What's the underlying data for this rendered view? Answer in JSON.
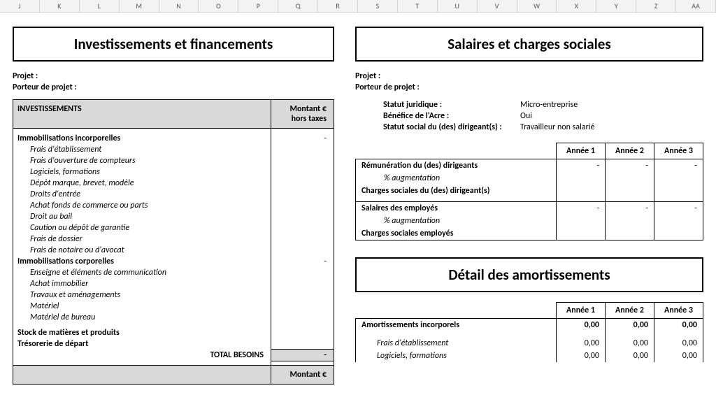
{
  "columns": [
    "J",
    "K",
    "L",
    "M",
    "N",
    "O",
    "P",
    "Q",
    "R",
    "S",
    "T",
    "U",
    "V",
    "W",
    "X",
    "Y",
    "Z",
    "AA"
  ],
  "left": {
    "title": "Investissements et financements",
    "meta": {
      "project": "Projet :",
      "carrier": "Porteur de projet :"
    },
    "header": {
      "label": "INVESTISSEMENTS",
      "amount": "Montant € hors taxes"
    },
    "sec_incorp": "Immobilisations incorporelles",
    "incorp_items": [
      "Frais d'établissement",
      "Frais d'ouverture de compteurs",
      "Logiciels, formations",
      "Dépôt marque, brevet, modèle",
      "Droits d'entrée",
      "Achat fonds de commerce ou parts",
      "Droit au bail",
      "Caution ou dépôt de garantie",
      "Frais de dossier",
      "Frais de notaire ou d'avocat"
    ],
    "sec_corp": "Immobilisations corporelles",
    "corp_items": [
      "Enseigne et éléments de communication",
      "Achat immobilier",
      "Travaux et aménagements",
      "Matériel",
      "Matériel de bureau"
    ],
    "stock": "Stock de matières et produits",
    "treso": "Trésorerie de départ",
    "total": "TOTAL BESOINS",
    "dash": "-",
    "footer_amount": "Montant €"
  },
  "right": {
    "title1": "Salaires et charges sociales",
    "meta": {
      "project": "Projet :",
      "carrier": "Porteur de projet :"
    },
    "status": [
      {
        "k": "Statut juridique :",
        "v": "Micro-entreprise"
      },
      {
        "k": "Bénéfice de l'Acre :",
        "v": "Oui"
      },
      {
        "k": "Statut social du (des) dirigeant(s) :",
        "v": "Travailleur non salarié"
      }
    ],
    "years": [
      "Année 1",
      "Année 2",
      "Année 3"
    ],
    "sal_rows": [
      {
        "lbl": "Rémunération du (des) dirigeants",
        "bold": true,
        "vals": [
          "-",
          "-",
          "-"
        ],
        "top": true
      },
      {
        "lbl": "% augmentation",
        "it": true,
        "vals": [
          "",
          "",
          ""
        ]
      },
      {
        "lbl": "Charges sociales du (des) dirigeant(s)",
        "bold": true,
        "vals": [
          "",
          "",
          ""
        ]
      },
      {
        "spacer": true
      },
      {
        "lbl": "Salaires des employés",
        "bold": true,
        "vals": [
          "-",
          "-",
          "-"
        ],
        "top": true
      },
      {
        "lbl": "% augmentation",
        "it": true,
        "vals": [
          "",
          "",
          ""
        ]
      },
      {
        "lbl": "Charges sociales employés",
        "bold": true,
        "vals": [
          "",
          "",
          ""
        ],
        "bottom": true
      }
    ],
    "title2": "Détail des amortissements",
    "amort_rows": [
      {
        "lbl": "Amortissements incorporels",
        "bold": true,
        "vals": [
          "0,00",
          "0,00",
          "0,00"
        ],
        "top": true
      },
      {
        "spacer": true
      },
      {
        "lbl": "Frais d'établissement",
        "it": true,
        "vals": [
          "0,00",
          "0,00",
          "0,00"
        ]
      },
      {
        "lbl": "Logiciels, formations",
        "it": true,
        "vals": [
          "0,00",
          "0,00",
          "0,00"
        ]
      }
    ]
  }
}
